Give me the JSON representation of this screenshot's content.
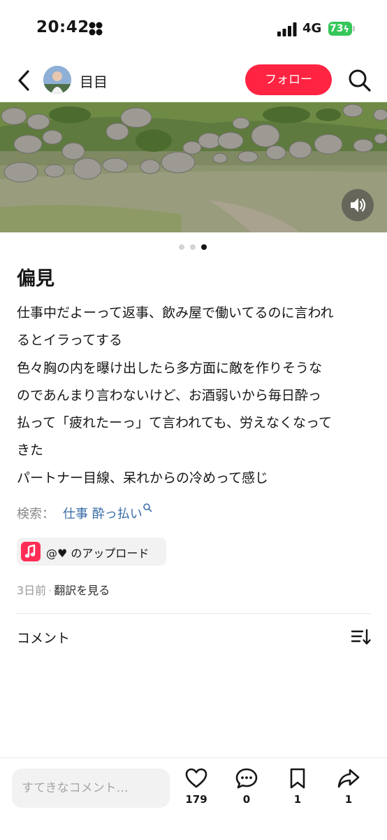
{
  "status_bar": {
    "time": "20:42",
    "network": "4G",
    "battery": "73"
  },
  "header": {
    "username": "目目",
    "follow_label": "フォロー"
  },
  "post": {
    "title": "偏見",
    "body_lines": [
      "仕事中だよーって返事、飲み屋で働いてるのに言われ",
      "るとイラってする",
      "色々胸の内を曝け出したら多方面に敵を作りそうな",
      "のであんまり言わないけど、お酒弱いから毎日酔っ",
      "払って「疲れたーっ」て言われても、労えなくなって",
      "きた",
      "パートナー目線、呆れからの冷めって感じ"
    ],
    "search_label": "検索：",
    "search_term": "仕事 酔っ払い",
    "music_label": "@♥ のアップロード",
    "date": "3日前",
    "translate_label": "翻訳を見る",
    "carousel": {
      "count": 3,
      "active_index": 2
    }
  },
  "comments": {
    "title": "コメント"
  },
  "bottom_bar": {
    "comment_placeholder": "すてきなコメント…",
    "like_count": "179",
    "comment_count": "0",
    "save_count": "1",
    "share_count": "1"
  },
  "colors": {
    "accent": "#ff2442",
    "link": "#3a6ea8",
    "music_badge": "#ff2d55",
    "battery": "#34c759"
  }
}
